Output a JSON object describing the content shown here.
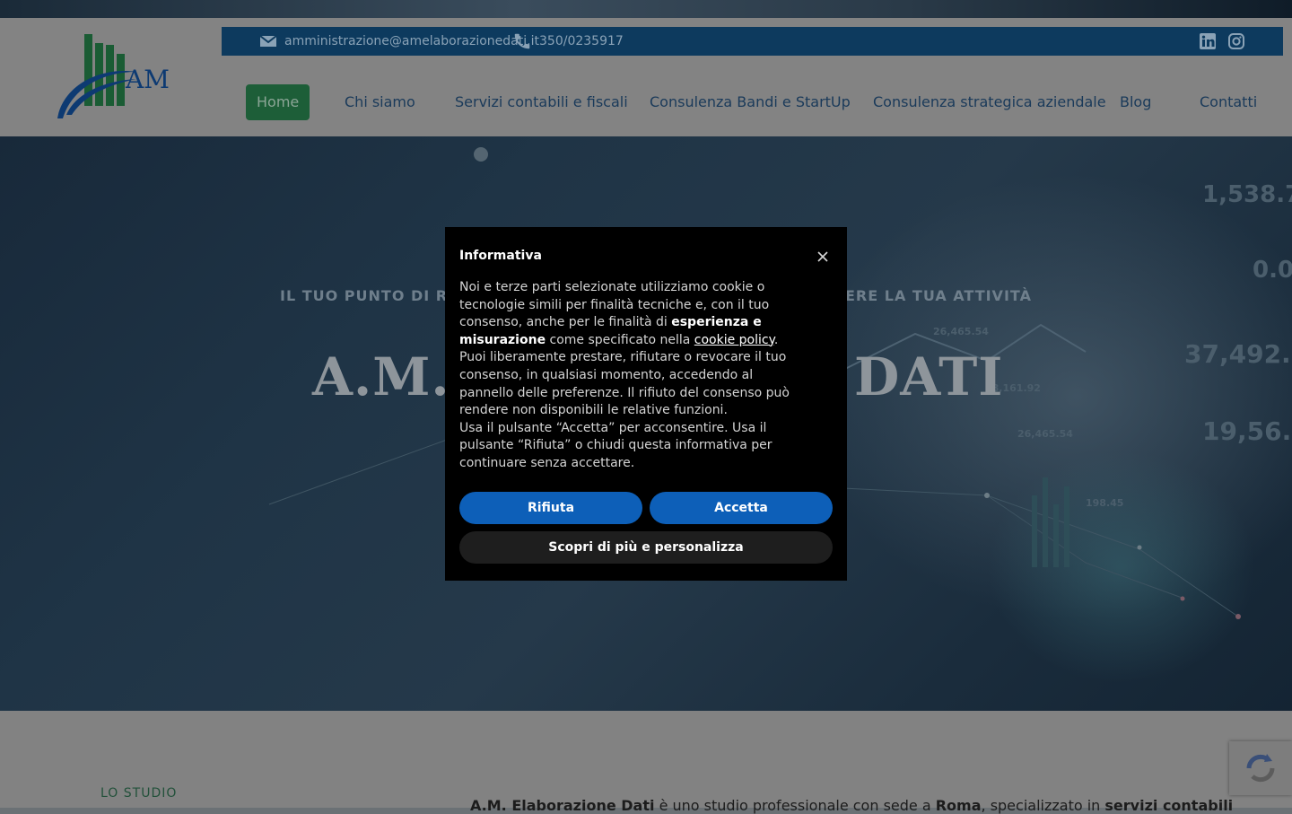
{
  "header": {
    "email": "amministrazione@amelaborazionedati.it",
    "phone": "350/0235917",
    "logo_text": "AM",
    "social": [
      "linkedin-icon",
      "instagram-icon"
    ]
  },
  "nav": {
    "items": [
      {
        "label": "Home",
        "active": true
      },
      {
        "label": "Chi siamo"
      },
      {
        "label": "Servizi contabili e fiscali"
      },
      {
        "label": "Consulenza Bandi e StartUp"
      },
      {
        "label": "Consulenza strategica aziendale"
      },
      {
        "label": "Blog"
      },
      {
        "label": "Contatti"
      }
    ]
  },
  "hero": {
    "tagline_left": "IL TUO PUNTO DI RIFE",
    "tagline_right": "ERE LA TUA ATTIVITÀ",
    "title_left": "A.M. E",
    "title_right": "DATI",
    "chart_numbers": [
      "1,538.7",
      "0.0",
      "26,465.54",
      "37,492.1",
      "28,161.92",
      "19,56.9",
      "26,465.54",
      "198.45"
    ]
  },
  "section": {
    "label": "LO STUDIO",
    "text_1": "A.M. Elaborazione Dati",
    "text_2": " è uno studio professionale con sede a ",
    "text_3": "Roma",
    "text_4": ", specializzato in ",
    "text_5": "servizi contabili"
  },
  "modal": {
    "title": "Informativa",
    "p1_a": "Noi e terze parti selezionate utilizziamo cookie o tecnologie simili per finalità tecniche e, con il tuo consenso, anche per le finalità di ",
    "p1_b": "esperienza e misurazione",
    "p1_c": " come specificato nella ",
    "p1_link": "cookie policy",
    "p1_d": ".",
    "p2": "Puoi liberamente prestare, rifiutare o revocare il tuo consenso, in qualsiasi momento, accedendo al pannello delle preferenze. Il rifiuto del consenso può rendere non disponibili le relative funzioni.",
    "p3": "Usa il pulsante “Accetta” per acconsentire. Usa il pulsante “Rifiuta” o chiudi questa informativa per continuare senza accettare.",
    "reject_label": "Rifiuta",
    "accept_label": "Accetta",
    "customize_label": "Scopri di più e personalizza"
  },
  "colors": {
    "infobar": "#0d3a5e",
    "nav_active": "#1d5e38",
    "button_blue": "#0d5fb8",
    "modal_bg": "#000000"
  }
}
